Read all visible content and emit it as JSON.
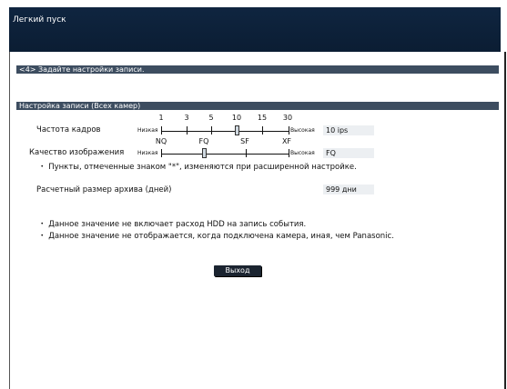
{
  "window": {
    "title": "Легкий пуск"
  },
  "step": {
    "label": "<4> Задайте настройки записи."
  },
  "section": {
    "label": "Настройка записи (Всех камер)"
  },
  "frame_rate": {
    "label": "Частота кадров",
    "low_label": "Низкая",
    "high_label": "Высокая",
    "scale_values": [
      "1",
      "3",
      "5",
      "10",
      "15",
      "30"
    ],
    "value": "10 ips"
  },
  "image_quality": {
    "label": "Качество изображения",
    "low_label": "Низкая",
    "high_label": "Высокая",
    "scale_values": [
      "NQ",
      "FQ",
      "SF",
      "XF"
    ],
    "value": "FQ"
  },
  "note_advanced": "・ Пункты, отмеченные знаком \"*\", изменяются при расширенной настройке.",
  "archive": {
    "label": "Расчетный размер архива (дней)",
    "value": "999 дни"
  },
  "notes": [
    "・ Данное значение не включает расход HDD на запись события.",
    "・ Данное значение не отображается, когда подключена камера, иная, чем Panasonic."
  ],
  "buttons": {
    "exit": "Выход"
  }
}
